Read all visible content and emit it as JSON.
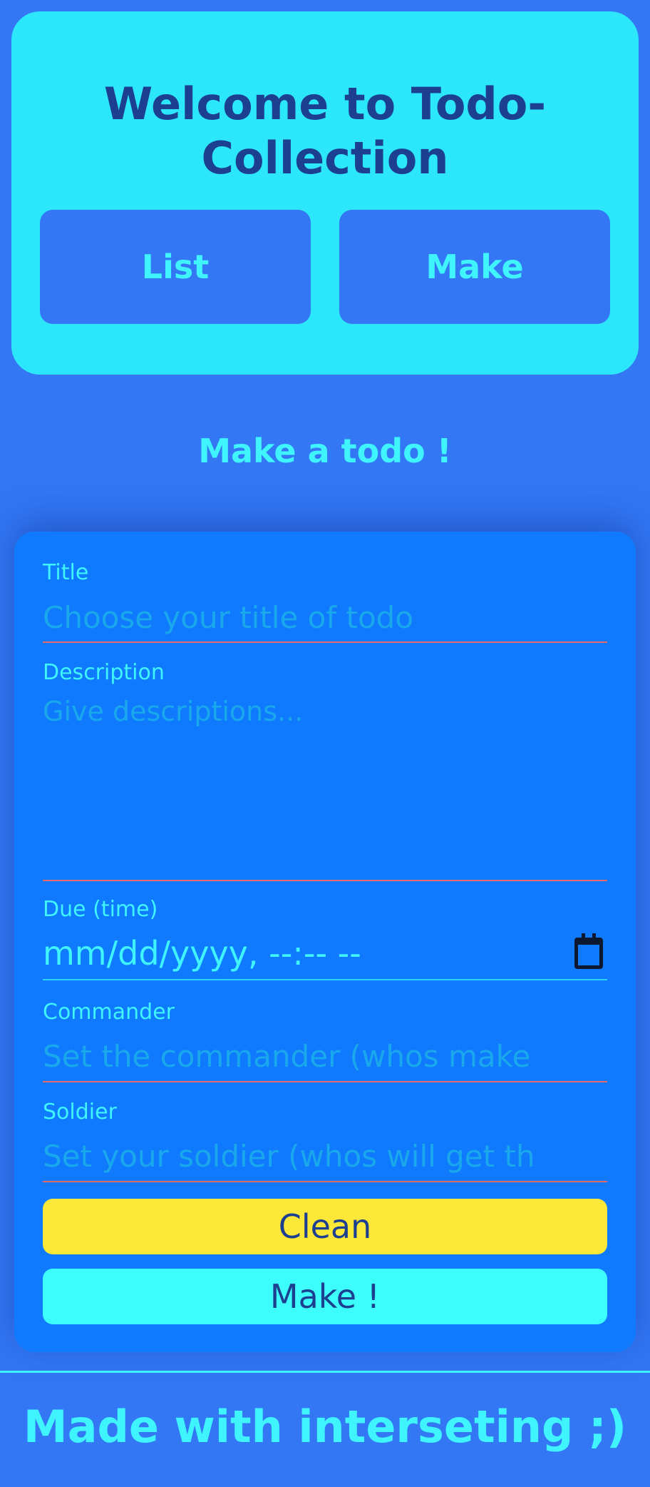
{
  "header": {
    "title": "Welcome to Todo-Collection",
    "nav": {
      "list_label": "List",
      "make_label": "Make"
    }
  },
  "section_heading": "Make a todo !",
  "form": {
    "title": {
      "label": "Title",
      "placeholder": "Choose your title of todo"
    },
    "description": {
      "label": "Description",
      "placeholder": "Give descriptions..."
    },
    "due": {
      "label": "Due (time)",
      "value": "mm/dd/yyyy, --:-- --",
      "icon": "calendar-icon"
    },
    "commander": {
      "label": "Commander",
      "placeholder": "Set the commander (whos make"
    },
    "soldier": {
      "label": "Soldier",
      "placeholder": "Set your soldier (whos will get th"
    },
    "clean_label": "Clean",
    "make_label": "Make !"
  },
  "footer": {
    "text": "Made with interseting ;)"
  },
  "colors": {
    "background": "#3377f5",
    "header_card": "#2ce6fc",
    "form_card": "#0f7afd",
    "accent_cyan": "#3ff4fc",
    "clean_button": "#fce838",
    "make_button": "#3dfcfc",
    "dark_text": "#1d3f8f",
    "input_underline": "#e56b6b"
  }
}
